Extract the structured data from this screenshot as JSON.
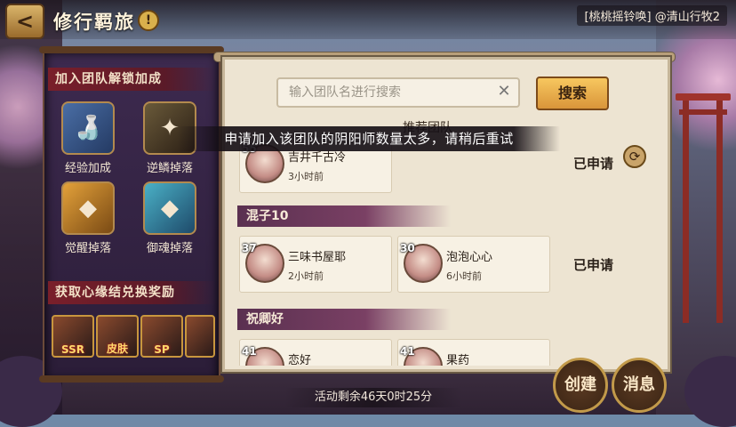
{
  "header": {
    "title": "修行羁旅",
    "back_label": "<",
    "info_label": "!",
    "server": "[桃桃摇铃唤] @清山行牧2"
  },
  "left_panel": {
    "bonus_title": "加入团队解锁加成",
    "bonuses": [
      {
        "label": "经验加成",
        "icon": "sake-bottle-icon"
      },
      {
        "label": "逆鳞掉落",
        "icon": "dragon-scale-icon"
      },
      {
        "label": "觉醒掉落",
        "icon": "awaken-charm-icon"
      },
      {
        "label": "御魂掉落",
        "icon": "soul-charm-icon"
      }
    ],
    "exchange_title": "获取心缘结兑换奖励",
    "rewards": [
      "SSR",
      "皮肤",
      "SP",
      ""
    ]
  },
  "search": {
    "placeholder": "输入团队名进行搜索",
    "button": "搜索"
  },
  "recommend_title": "推荐团队",
  "teams": [
    {
      "name": "",
      "members": [
        {
          "level": "55",
          "name": "吉井千古冷",
          "time": "3小时前"
        }
      ],
      "status": "已申请"
    },
    {
      "name": "混子10",
      "members": [
        {
          "level": "37",
          "name": "三味书屋耶",
          "time": "2小时前"
        },
        {
          "level": "30",
          "name": "泡泡心心",
          "time": "6小时前"
        }
      ],
      "status": "已申请"
    },
    {
      "name": "祝卿好",
      "members": [
        {
          "level": "41",
          "name": "恋好",
          "time": ""
        },
        {
          "level": "41",
          "name": "果药",
          "time": ""
        }
      ],
      "status": ""
    }
  ],
  "toast": "申请加入该团队的阴阳师数量太多，请稍后重试",
  "footer": {
    "timer": "活动剩余46天0时25分",
    "create_label": "创建",
    "message_label": "消息"
  },
  "colors": {
    "accent_gold": "#d9953a",
    "team_banner": "#5a3050",
    "panel_bg": "#ede4d2"
  }
}
